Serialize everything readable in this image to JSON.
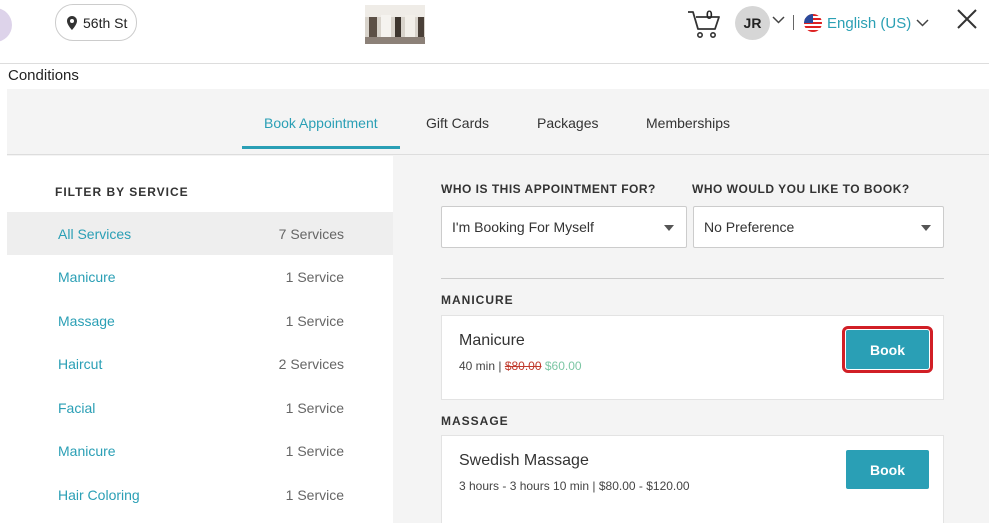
{
  "header": {
    "location_label": "56th St",
    "cart_count": "0",
    "avatar_initials": "JR",
    "language_label": "English (US)"
  },
  "page": {
    "conditions_label": "Conditions"
  },
  "tabs": [
    {
      "label": "Book Appointment",
      "active": true
    },
    {
      "label": "Gift Cards",
      "active": false
    },
    {
      "label": "Packages",
      "active": false
    },
    {
      "label": "Memberships",
      "active": false
    }
  ],
  "sidebar": {
    "title": "FILTER BY SERVICE",
    "items": [
      {
        "name": "All Services",
        "count": "7 Services",
        "active": true
      },
      {
        "name": "Manicure",
        "count": "1 Service",
        "active": false
      },
      {
        "name": "Massage",
        "count": "1 Service",
        "active": false
      },
      {
        "name": "Haircut",
        "count": "2 Services",
        "active": false
      },
      {
        "name": "Facial",
        "count": "1 Service",
        "active": false
      },
      {
        "name": "Manicure",
        "count": "1 Service",
        "active": false
      },
      {
        "name": "Hair Coloring",
        "count": "1 Service",
        "active": false
      }
    ]
  },
  "booking": {
    "who_for_label": "WHO IS THIS APPOINTMENT FOR?",
    "who_for_value": "I'm Booking For Myself",
    "who_book_label": "WHO WOULD YOU LIKE TO BOOK?",
    "who_book_value": "No Preference"
  },
  "categories": [
    {
      "title": "MANICURE",
      "service": {
        "name": "Manicure",
        "duration": "40 min",
        "separator": " | ",
        "original_price": "$80.00",
        "sale_price": "$60.00",
        "book_label": "Book"
      }
    },
    {
      "title": "MASSAGE",
      "service": {
        "name": "Swedish Massage",
        "meta": "3 hours - 3 hours 10 min | $80.00 - $120.00",
        "book_label": "Book"
      }
    }
  ],
  "colors": {
    "accent": "#2a9fb5",
    "highlight_border": "#d11f26",
    "strike_price": "#c0392b",
    "sale_price": "#7cc6a4"
  }
}
